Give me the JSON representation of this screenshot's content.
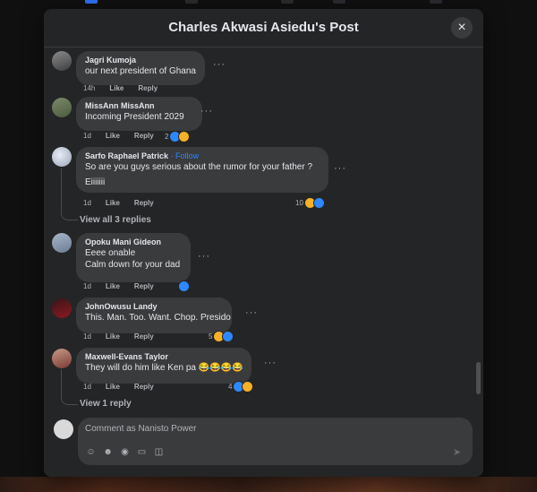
{
  "header": {
    "title": "Charles Akwasi Asiedu's Post",
    "close_icon": "×"
  },
  "comments": [
    {
      "author": "Jagri Kumoja",
      "lines": [
        "our next president of Ghana"
      ],
      "meta": {
        "time": "14h",
        "like": "Like",
        "reply": "Reply"
      }
    },
    {
      "author": "MissAnn MissAnn",
      "lines": [
        "Incoming President 2029"
      ],
      "meta": {
        "time": "1d",
        "like": "Like",
        "reply": "Reply"
      },
      "reaction_count": "2"
    },
    {
      "author": "Sarfo Raphael Patrick",
      "follow": "· Follow",
      "lines": [
        "So are you guys serious about the rumor for your father ?",
        "Eiiiiiii"
      ],
      "meta": {
        "time": "1d",
        "like": "Like",
        "reply": "Reply"
      },
      "reaction_count": "10",
      "view_replies": "View all 3 replies"
    },
    {
      "author": "Opoku Mani Gideon",
      "lines": [
        "Eeee onable",
        "Calm down for your dad"
      ],
      "meta": {
        "time": "1d",
        "like": "Like",
        "reply": "Reply"
      }
    },
    {
      "author": "JohnOwusu Landy",
      "lines": [
        "This. Man. Too. Want. Chop. Presido"
      ],
      "meta": {
        "time": "1d",
        "like": "Like",
        "reply": "Reply"
      },
      "reaction_count": "5"
    },
    {
      "author": "Maxwell-Evans Taylor",
      "lines": [
        "They will do him like Ken pa 😂😂😂😂"
      ],
      "meta": {
        "time": "1d",
        "like": "Like",
        "reply": "Reply"
      },
      "reaction_count": "4",
      "view_replies": "View 1 reply"
    }
  ],
  "composer": {
    "placeholder": "Comment as Nanisto Power"
  },
  "more_options": "···",
  "colors": {
    "background": "#242526",
    "bubble": "#3a3b3c",
    "accent": "#2d88ff",
    "text": "#e4e6eb",
    "muted": "#b0b3b8"
  },
  "icons": [
    "close-icon",
    "more-options-icon",
    "like-reaction-icon",
    "laugh-reaction-icon",
    "avatar-sticker-icon",
    "emoji-icon",
    "camera-icon",
    "gif-icon",
    "sticker-icon",
    "send-icon"
  ]
}
